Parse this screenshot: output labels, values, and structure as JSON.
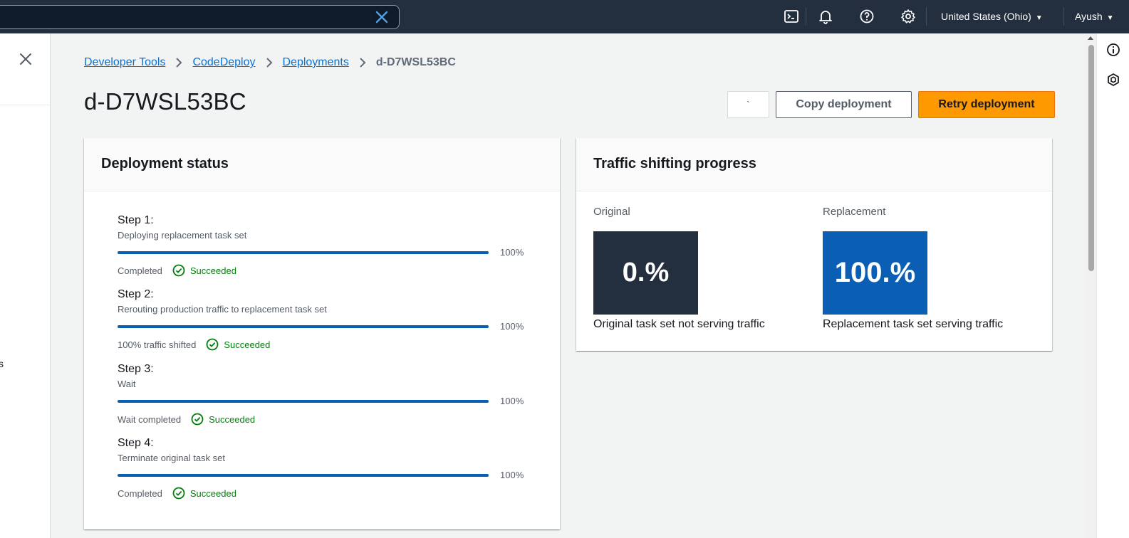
{
  "topbar": {
    "region": "United States (Ohio)",
    "user": "Ayush",
    "icons": [
      "cloudshell-icon",
      "bell-icon",
      "help-icon",
      "gear-icon"
    ]
  },
  "leftnav": {
    "cut_text": "s"
  },
  "breadcrumb": {
    "items": [
      "Developer Tools",
      "CodeDeploy",
      "Deployments"
    ],
    "current": "d-D7WSL53BC"
  },
  "page": {
    "title": "d-D7WSL53BC",
    "small_button": "`",
    "copy_button": "Copy deployment",
    "retry_button": "Retry deployment"
  },
  "deployment_status": {
    "title": "Deployment status",
    "steps": [
      {
        "title": "Step 1:",
        "desc": "Deploying replacement task set",
        "progress": 100,
        "percent": "100%",
        "status_label": "Completed",
        "result": "Succeeded"
      },
      {
        "title": "Step 2:",
        "desc": "Rerouting production traffic to replacement task set",
        "progress": 100,
        "percent": "100%",
        "status_label": "100% traffic shifted",
        "result": "Succeeded"
      },
      {
        "title": "Step 3:",
        "desc": "Wait",
        "progress": 100,
        "percent": "100%",
        "status_label": "Wait completed",
        "result": "Succeeded"
      },
      {
        "title": "Step 4:",
        "desc": "Terminate original task set",
        "progress": 100,
        "percent": "100%",
        "status_label": "Completed",
        "result": "Succeeded"
      }
    ]
  },
  "traffic": {
    "title": "Traffic shifting progress",
    "original": {
      "label": "Original",
      "value": "0.%",
      "caption": "Original task set not serving traffic",
      "color": "#232f3e"
    },
    "replacement": {
      "label": "Replacement",
      "value": "100.%",
      "caption": "Replacement task set serving traffic",
      "color": "#0a5fb4"
    }
  },
  "colors": {
    "accent": "#ff9900",
    "link": "#0972d3",
    "success": "#037f0c",
    "progress": "#0a5fb4"
  }
}
